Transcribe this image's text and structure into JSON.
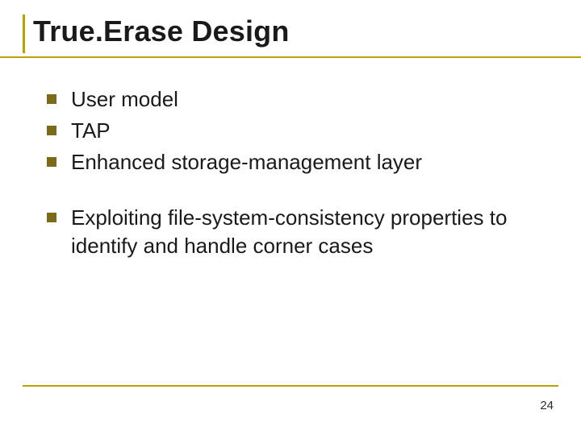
{
  "title": "True.Erase Design",
  "group1": [
    "User model",
    "TAP",
    "Enhanced storage-management layer"
  ],
  "group2": [
    "Exploiting file-system-consistency properties to identify and handle corner cases"
  ],
  "pageNumber": "24"
}
